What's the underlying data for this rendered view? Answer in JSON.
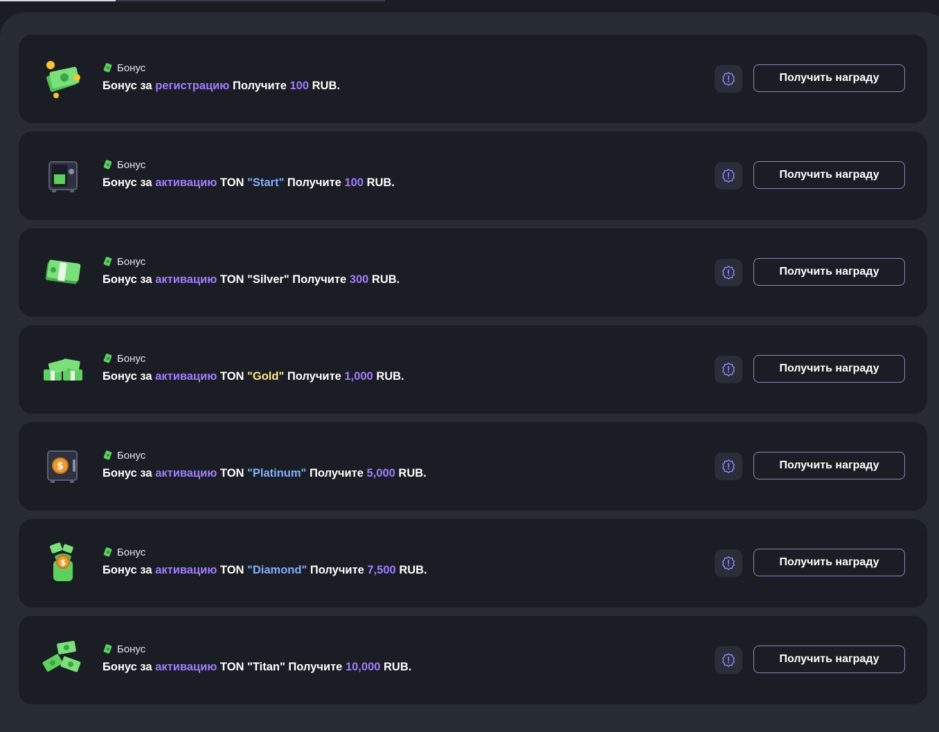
{
  "colors": {
    "accent": "#a07cff",
    "start_quote": "#7fb0ff",
    "gold_quote": "#ffe68a",
    "card_bg": "#1b1d24",
    "panel_bg": "#272b34"
  },
  "top_progress": 0.3,
  "common": {
    "tag_label": "Бонус",
    "claim_label": "Получить награду",
    "prefix": "Бонус за",
    "get_word": "Получите",
    "currency": "RUB."
  },
  "bonuses": [
    {
      "icon": "cash-stack-coins-icon",
      "action": "регистрацию",
      "ton": "",
      "package": "",
      "quote_style": "",
      "amount": "100"
    },
    {
      "icon": "safe-open-icon",
      "action": "активацию",
      "ton": "TON",
      "package": "\"Start\"",
      "quote_style": "blue",
      "amount": "100"
    },
    {
      "icon": "cash-bundle-icon",
      "action": "активацию",
      "ton": "TON",
      "package": "\"Silver\"",
      "quote_style": "white",
      "amount": "300"
    },
    {
      "icon": "cash-piles-icon",
      "action": "активацию",
      "ton": "TON",
      "package": "\"Gold\"",
      "quote_style": "yellow",
      "amount": "1,000"
    },
    {
      "icon": "safe-dollar-icon",
      "action": "активацию",
      "ton": "TON",
      "package": "\"Platinum\"",
      "quote_style": "blue",
      "amount": "5,000"
    },
    {
      "icon": "money-bag-cash-icon",
      "action": "активацию",
      "ton": "TON",
      "package": "\"Diamond\"",
      "quote_style": "blue",
      "amount": "7,500"
    },
    {
      "icon": "flying-cash-icon",
      "action": "активацию",
      "ton": "TON",
      "package": "\"Titan\"",
      "quote_style": "white",
      "amount": "10,000"
    }
  ]
}
